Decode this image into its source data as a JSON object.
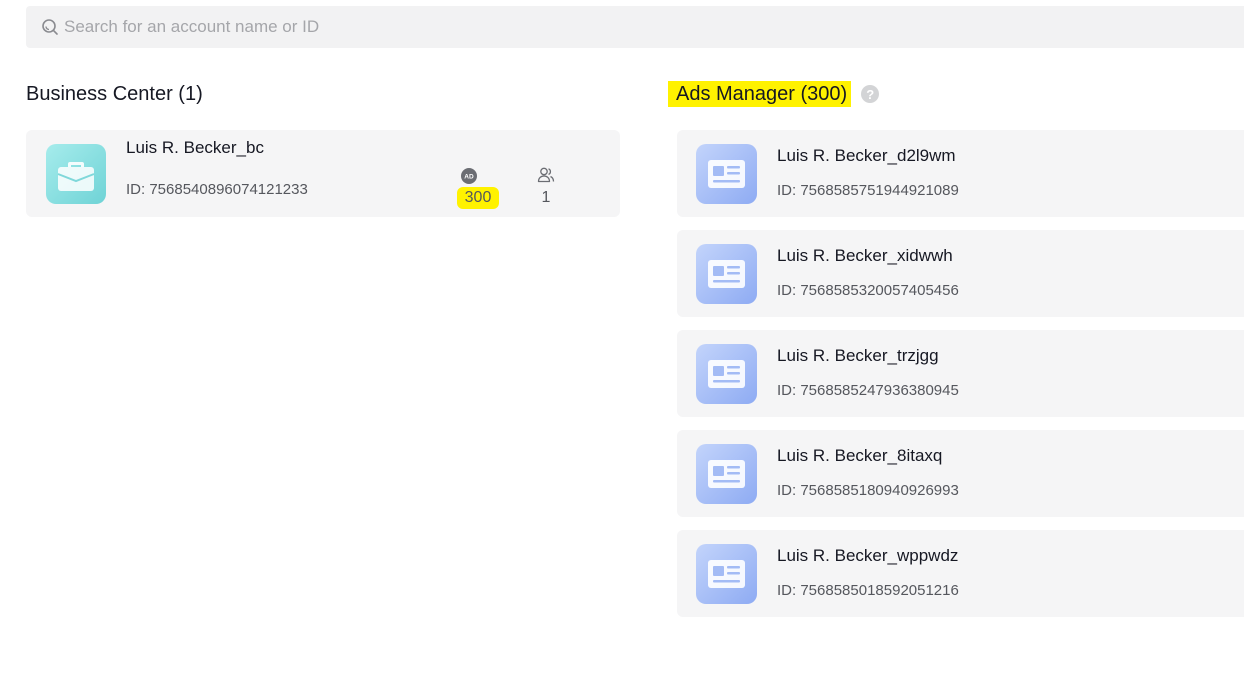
{
  "search": {
    "placeholder": "Search for an account name or ID"
  },
  "business_center": {
    "title": "Business Center (1)",
    "items": [
      {
        "name": "Luis R. Becker_bc",
        "id": "ID: 7568540896074121233",
        "ad_count": "300",
        "user_count": "1"
      }
    ]
  },
  "ads_manager": {
    "title": "Ads Manager (300)",
    "items": [
      {
        "name": "Luis R. Becker_d2l9wm",
        "id": "ID: 7568585751944921089"
      },
      {
        "name": "Luis R. Becker_xidwwh",
        "id": "ID: 7568585320057405456"
      },
      {
        "name": "Luis R. Becker_trzjgg",
        "id": "ID: 7568585247936380945"
      },
      {
        "name": "Luis R. Becker_8itaxq",
        "id": "ID: 7568585180940926993"
      },
      {
        "name": "Luis R. Becker_wppwdz",
        "id": "ID: 7568585018592051216"
      }
    ]
  },
  "icons": {
    "search": "search-icon",
    "help": "help-icon",
    "business_center": "briefcase-icon",
    "ad_count": "ad-icon",
    "user_count": "users-icon",
    "ad_account": "ad-account-icon"
  },
  "colors": {
    "highlight": "#fff200",
    "card_bg": "#f5f5f6",
    "bc_icon": "#8fe0e0",
    "am_icon": "#a8c0f7"
  }
}
